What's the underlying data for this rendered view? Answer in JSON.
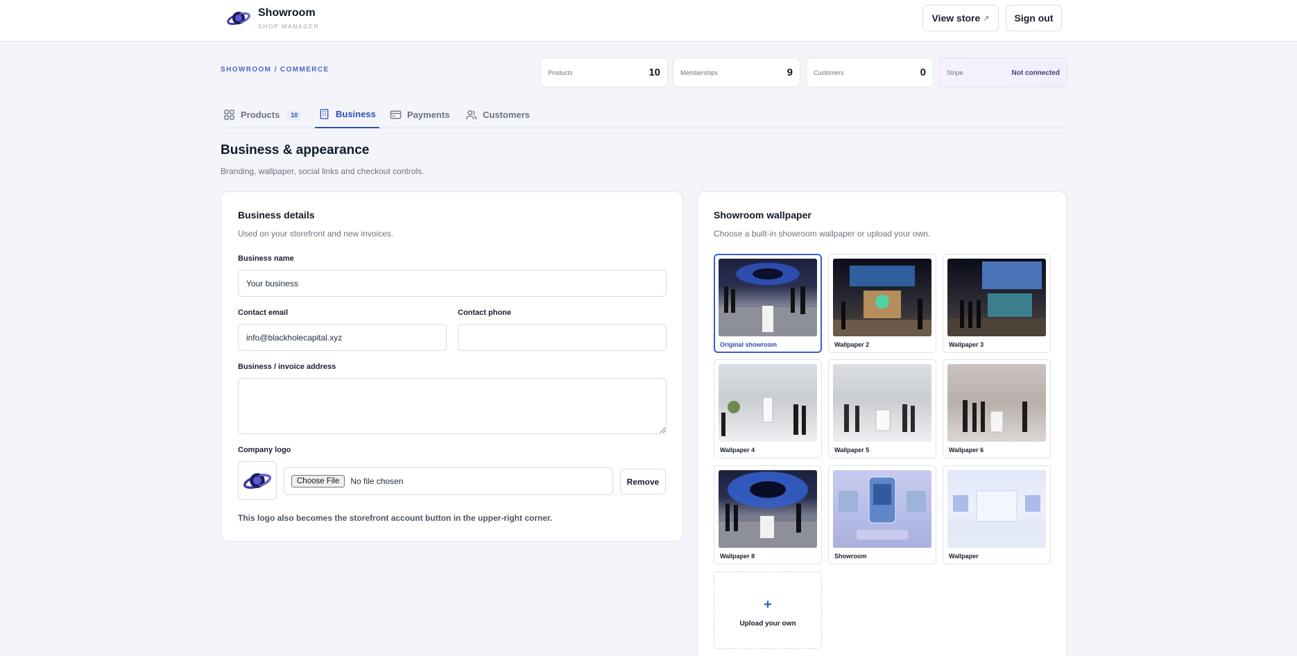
{
  "header": {
    "app_name": "Showroom",
    "app_subtitle": "SHOP MANAGER",
    "view_store_label": "View store",
    "view_store_icon": "external-link-icon",
    "sign_out_label": "Sign out"
  },
  "breadcrumb": "SHOWROOM / COMMERCE",
  "stats": [
    {
      "label": "Products",
      "value": "10"
    },
    {
      "label": "Memberships",
      "value": "9"
    },
    {
      "label": "Customers",
      "value": "0"
    },
    {
      "label": "Stripe",
      "value": "Not connected"
    }
  ],
  "tabs": [
    {
      "label": "Products",
      "count": "10",
      "icon": "grid-icon"
    },
    {
      "label": "Business",
      "icon": "building-icon",
      "active": true
    },
    {
      "label": "Payments",
      "icon": "credit-card-icon"
    },
    {
      "label": "Customers",
      "icon": "users-icon"
    }
  ],
  "page": {
    "title": "Business & appearance",
    "subtitle": "Branding, wallpaper, social links and checkout controls."
  },
  "business": {
    "title": "Business details",
    "subtitle": "Used on your storefront and new invoices.",
    "name_label": "Business name",
    "name_value": "Your business",
    "email_label": "Contact email",
    "email_value": "info@blackholecapital.xyz",
    "phone_label": "Contact phone",
    "phone_value": "",
    "address_label": "Business / invoice address",
    "address_value": "",
    "logo_label": "Company logo",
    "choose_file_label": "Choose File",
    "no_file_label": "No file chosen",
    "remove_label": "Remove",
    "logo_note": "This logo also becomes the storefront account button in the upper-right corner."
  },
  "wallpaper": {
    "title": "Showroom wallpaper",
    "subtitle": "Choose a built-in showroom wallpaper or upload your own.",
    "items": [
      {
        "label": "Original showroom",
        "selected": true
      },
      {
        "label": "Wallpaper 2"
      },
      {
        "label": "Wallpaper 3"
      },
      {
        "label": "Wallpaper 4"
      },
      {
        "label": "Wallpaper 5"
      },
      {
        "label": "Wallpaper 6"
      },
      {
        "label": "Wallpaper 8"
      },
      {
        "label": "Showroom"
      },
      {
        "label": "Wallpaper"
      }
    ],
    "upload_icon": "plus-icon",
    "upload_label": "Upload your own"
  },
  "colors": {
    "accent": "#2f4db5",
    "page_bg": "#f3f5fa",
    "card_bg": "#ffffff"
  }
}
